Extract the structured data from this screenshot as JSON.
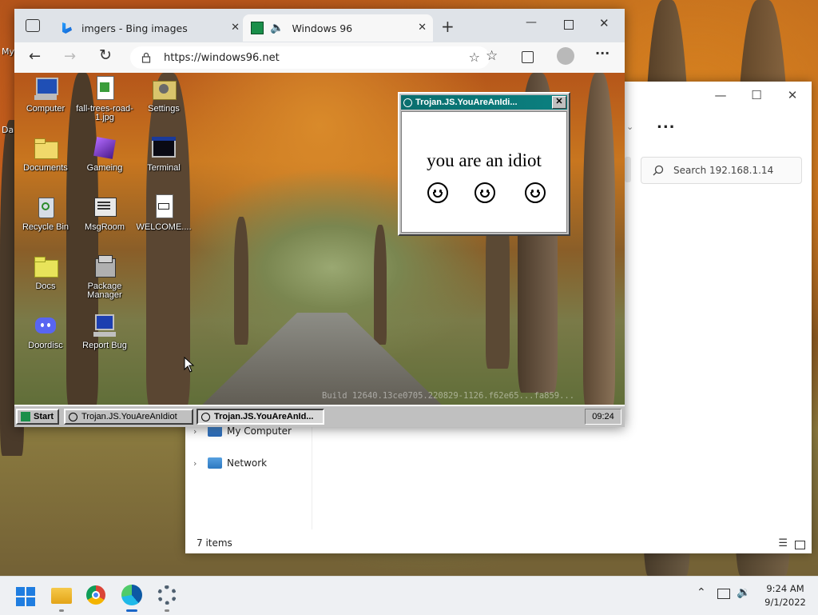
{
  "desktop": {
    "edge_glyph_1": "My",
    "edge_glyph_2": "Da"
  },
  "explorer": {
    "search_placeholder": "Search 192.168.1.14",
    "more_label": "...",
    "nav": [
      {
        "label": "My Computer",
        "icon": "computer-icon"
      },
      {
        "label": "Network",
        "icon": "network-icon"
      }
    ],
    "status": "7 items"
  },
  "browser": {
    "tabs": [
      {
        "label": "imgers - Bing images",
        "icon": "bing-icon"
      },
      {
        "label": "Windows 96",
        "icon": "windows96-icon"
      }
    ],
    "url": "https://windows96.net"
  },
  "w96": {
    "icons": [
      {
        "label": "Computer",
        "icon": "computer-icon"
      },
      {
        "label": "fall-trees-road-1.jpg",
        "icon": "image-file-icon"
      },
      {
        "label": "Settings",
        "icon": "settings-icon"
      },
      {
        "label": "Documents",
        "icon": "folder-icon"
      },
      {
        "label": "Gameing",
        "icon": "cube-icon"
      },
      {
        "label": "Terminal",
        "icon": "terminal-icon"
      },
      {
        "label": "Recycle Bin",
        "icon": "recycle-bin-icon"
      },
      {
        "label": "MsgRoom",
        "icon": "msgroom-icon"
      },
      {
        "label": "WELCOME....",
        "icon": "markdown-file-icon"
      },
      {
        "label": "Docs",
        "icon": "folder-icon"
      },
      {
        "label": "Package Manager",
        "icon": "package-icon"
      },
      {
        "label": "Doordisc",
        "icon": "discord-icon"
      },
      {
        "label": "Report Bug",
        "icon": "bug-report-icon"
      }
    ],
    "watermark": "Build 12640.13ce0705.220829-1126.f62e65...fa859...",
    "taskbar": {
      "start": "Start",
      "items": [
        "Trojan.JS.YouAreAnIdiot",
        "Trojan.JS.YouAreAnId..."
      ],
      "clock": "09:24"
    },
    "popup": {
      "title": "Trojan.JS.YouAreAnIdi...",
      "message": "you are an idiot"
    }
  },
  "taskbar": {
    "time": "9:24 AM",
    "date": "9/1/2022"
  }
}
